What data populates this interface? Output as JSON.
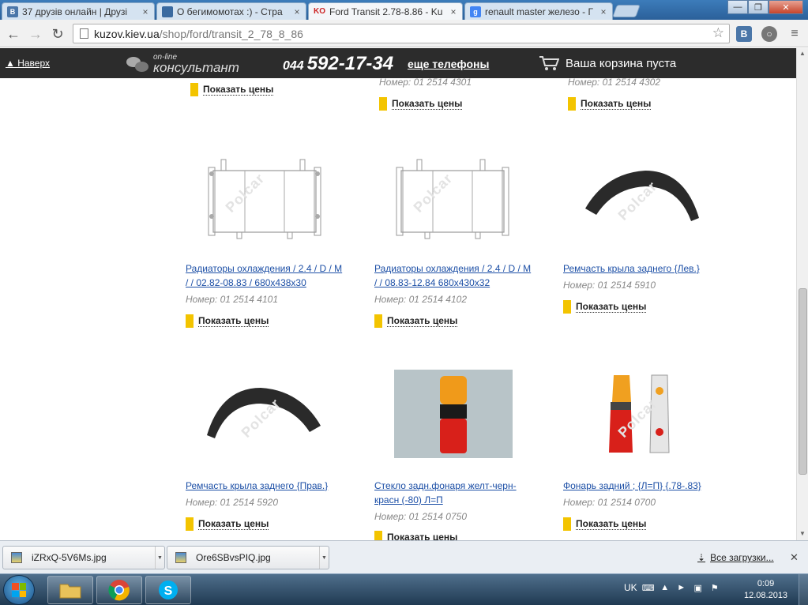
{
  "browser": {
    "tabs": [
      {
        "title": "37 друзів онлайн | Друзі",
        "favicon": "В",
        "favicon_color": "#4a76a8",
        "active": false
      },
      {
        "title": "О бегимомотах :) - Стра",
        "favicon": "",
        "favicon_color": "#3a6aa0",
        "active": false
      },
      {
        "title": "Ford Transit 2.78-8.86 - Ku",
        "favicon": "KO",
        "favicon_color": "#cc2222",
        "active": true
      },
      {
        "title": "renault master железо - Г",
        "favicon": "g",
        "favicon_color": "#4285f4",
        "active": false
      }
    ],
    "tab_close_glyph": "×",
    "url_host": "kuzov.kiev.ua",
    "url_path": "/shop/ford/transit_2_78_8_86",
    "window_buttons": {
      "minimize": "—",
      "maximize": "❐",
      "close": "✕"
    }
  },
  "site": {
    "up_link": "▲ Наверх",
    "consult_small": "on-line",
    "consult_big": "консультант",
    "phone_code": "044",
    "phone_number": "592-17-34",
    "more_phones": "еще телефоны",
    "cart_text": "Ваша корзина пуста"
  },
  "price_label": "Показать цены",
  "top_row": [
    {
      "number": "",
      "price": "Показать цены"
    },
    {
      "number": "Номер: 01 2514 4301",
      "price": "Показать цены"
    },
    {
      "number": "Номер: 01 2514 4302",
      "price": "Показать цены"
    }
  ],
  "products": [
    {
      "title_line1": "Радиаторы охлаждения / 2.4 / D / M",
      "title_line2": "/ / 02.82-08.83 / 680x438x30",
      "number": "Номер: 01 2514 4101",
      "image": "radiator"
    },
    {
      "title_line1": "Радиаторы охлаждения / 2.4 / D / M",
      "title_line2": "/ / 08.83-12.84 680x430x32",
      "number": "Номер: 01 2514 4102",
      "image": "radiator"
    },
    {
      "title_line1": "Ремчасть крыла заднего {Лев.}",
      "title_line2": "",
      "number": "Номер: 01 2514 5910",
      "image": "arch-left"
    },
    {
      "title_line1": "Ремчасть крыла заднего {Прав.}",
      "title_line2": "",
      "number": "Номер: 01 2514 5920",
      "image": "arch-right"
    },
    {
      "title_line1": "Стекло задн.фонаря желт-черн-",
      "title_line2": "красн (-80) Л=П",
      "number": "Номер: 01 2514 0750",
      "image": "lamp-glass"
    },
    {
      "title_line1": "Фонарь задний ; {Л=П} {.78-.83}",
      "title_line2": "",
      "number": "Номер: 01 2514 0700",
      "image": "tail-lamps"
    }
  ],
  "watermark": "Polcar",
  "downloads": {
    "items": [
      "iZRxQ-5V6Ms.jpg",
      "Ore6SBvsPIQ.jpg"
    ],
    "all_label": "Все загрузки...",
    "close_glyph": "✕"
  },
  "taskbar": {
    "lang": "UK",
    "time": "0:09",
    "date": "12.08.2013"
  },
  "colors": {
    "site_bar": "#2c2c2c",
    "price_mark": "#f3c400",
    "link": "#1c4fa6"
  }
}
